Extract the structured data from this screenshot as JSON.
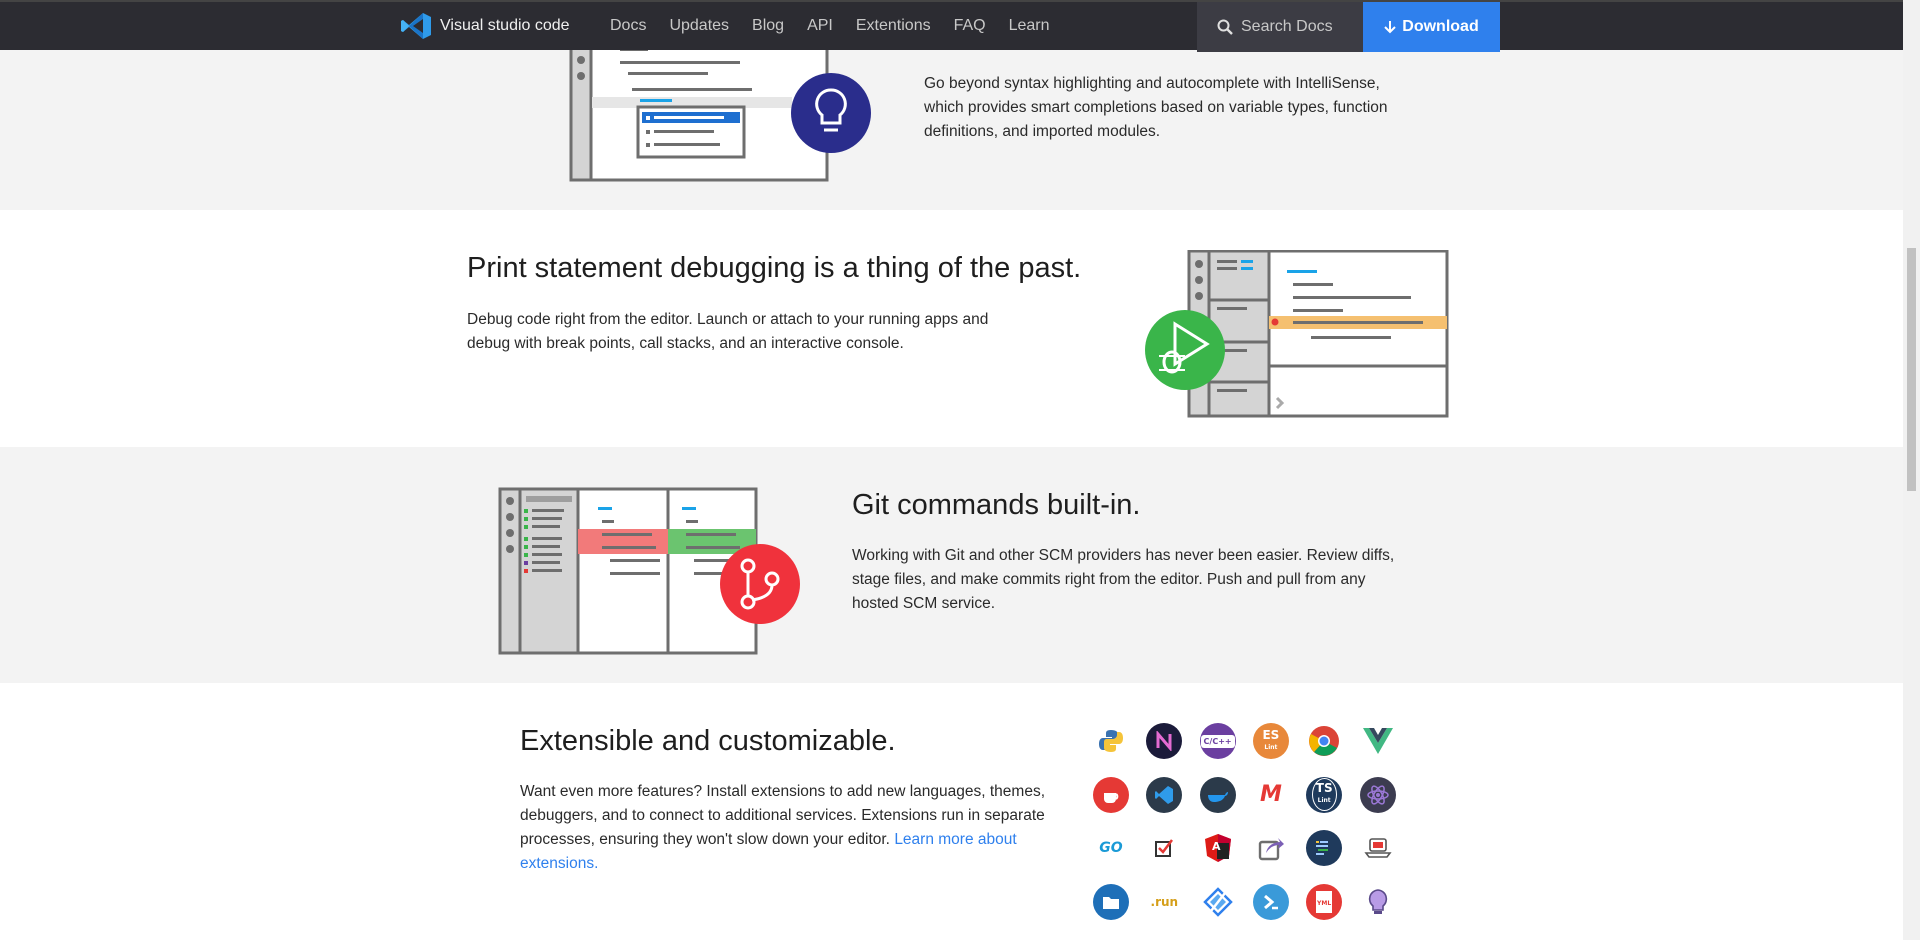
{
  "nav": {
    "brand": "Visual studio code",
    "links": [
      "Docs",
      "Updates",
      "Blog",
      "API",
      "Extentions",
      "FAQ",
      "Learn"
    ],
    "search_placeholder": "Search Docs",
    "download_label": "Download"
  },
  "intellisense": {
    "body": "Go beyond syntax highlighting and autocomplete with IntelliSense, which provides smart completions based on variable types, function definitions, and imported modules."
  },
  "debugging": {
    "title": "Print statement debugging is a thing of the past.",
    "body": "Debug code right from the editor. Launch or attach to your running apps and debug with break points, call stacks, and an interactive console."
  },
  "git": {
    "title": "Git commands built-in.",
    "body": "Working with Git and other SCM providers has never been easier. Review diffs, stage files, and make commits right from the editor. Push and pull from any hosted SCM service."
  },
  "extensions": {
    "title": "Extensible and customizable.",
    "body": "Want even more features? Install extensions to add new languages, themes, debuggers, and to connect to additional services. Extensions run in separate processes, ensuring they won't slow down your editor.",
    "link": "Learn more about extensions.",
    "icons": [
      {
        "name": "python-icon",
        "label": "",
        "color": "#ffffff"
      },
      {
        "name": "npm-intellisense-icon",
        "label": "",
        "color": "#1b1b3a"
      },
      {
        "name": "cpp-icon",
        "label": "C/C++",
        "color": "#6b3fa0"
      },
      {
        "name": "eslint-icon",
        "label": "ES",
        "color": "#e8883a"
      },
      {
        "name": "chrome-icon",
        "label": "",
        "color": "#ffffff"
      },
      {
        "name": "vue-icon",
        "label": "",
        "color": "#ffffff"
      },
      {
        "name": "java-icon",
        "label": "",
        "color": "#e53935"
      },
      {
        "name": "vscode-icon",
        "label": "",
        "color": "#2b3a4a"
      },
      {
        "name": "docker-icon",
        "label": "",
        "color": "#2b3a4a"
      },
      {
        "name": "markdown-icon",
        "label": "M",
        "color": "#ffffff"
      },
      {
        "name": "tslint-icon",
        "label": "TS",
        "color": "#1f3a5c"
      },
      {
        "name": "atom-icon",
        "label": "",
        "color": "#3c3c50"
      },
      {
        "name": "go-icon",
        "label": "GO",
        "color": "#ffffff"
      },
      {
        "name": "todo-icon",
        "label": "",
        "color": "#ffffff"
      },
      {
        "name": "angular-icon",
        "label": "A",
        "color": "#ffffff"
      },
      {
        "name": "share-icon",
        "label": "",
        "color": "#ffffff"
      },
      {
        "name": "sublime-icon",
        "label": "",
        "color": "#1f3a5c"
      },
      {
        "name": "coffee-icon",
        "label": "",
        "color": "#ffffff"
      },
      {
        "name": "folder-icon",
        "label": "",
        "color": "#1e6fb8"
      },
      {
        "name": "run-icon",
        "label": ".run",
        "color": "#ffffff"
      },
      {
        "name": "diamond-icon",
        "label": "",
        "color": "#ffffff"
      },
      {
        "name": "powershell-icon",
        "label": "",
        "color": "#3a9ad9"
      },
      {
        "name": "yaml-icon",
        "label": "YML",
        "color": "#e53935"
      },
      {
        "name": "lightbulb-icon",
        "label": "",
        "color": "#ffffff"
      }
    ]
  },
  "colors": {
    "nav_bg": "#2c2c32",
    "download_bg": "#2f80ed",
    "section_gray": "#f3f3f3",
    "intellisense_accent": "#2a2d8c",
    "debug_accent": "#3ab54a",
    "git_accent": "#f0323c"
  }
}
